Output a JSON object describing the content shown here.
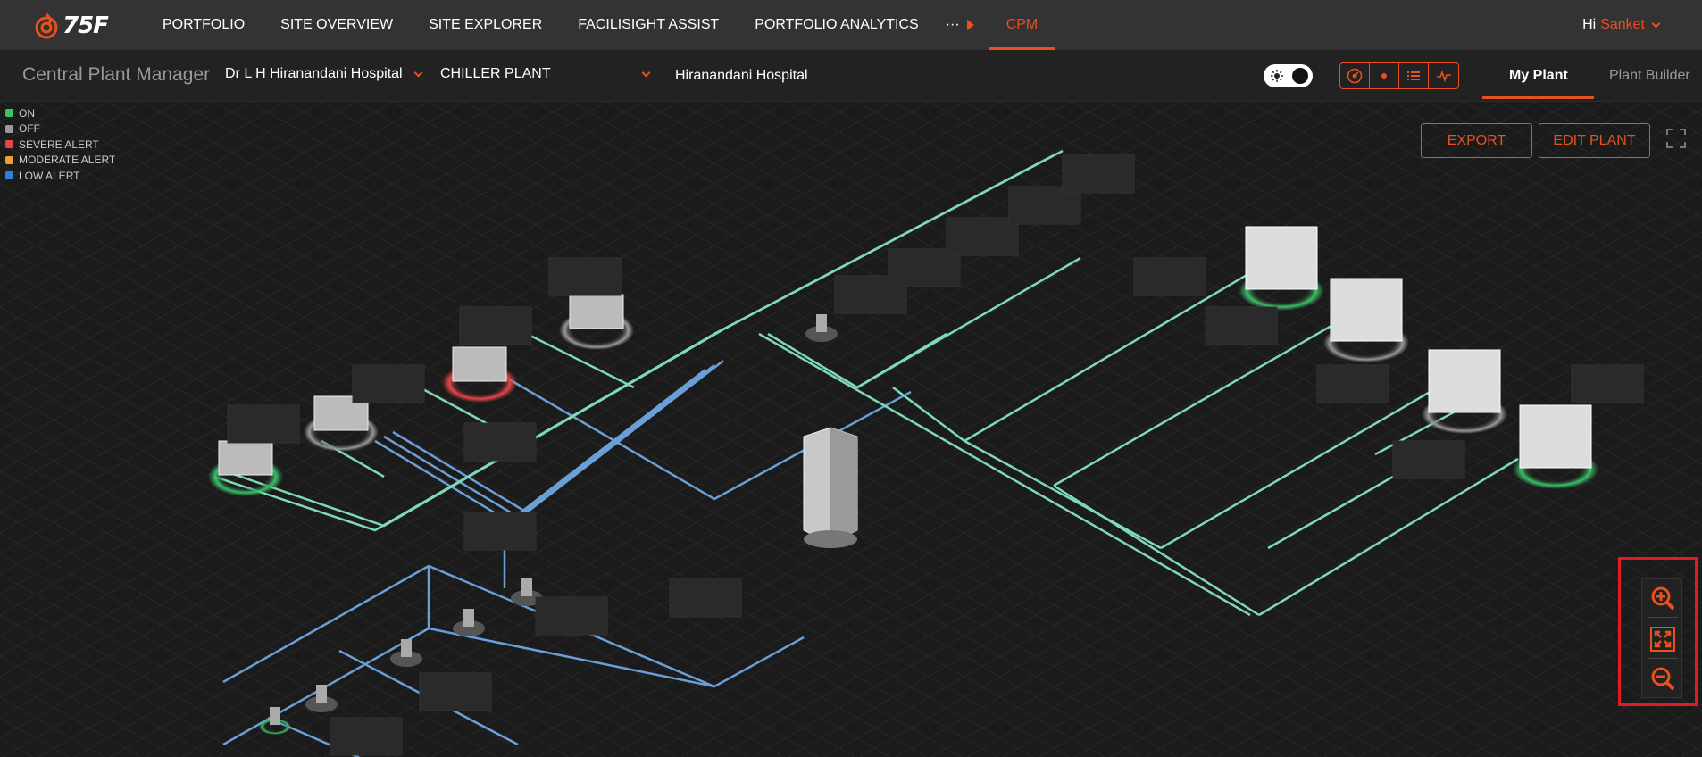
{
  "nav": {
    "logo_text": "75F",
    "items": [
      "PORTFOLIO",
      "SITE OVERVIEW",
      "SITE EXPLORER",
      "FACILISIGHT ASSIST",
      "PORTFOLIO ANALYTICS"
    ],
    "more": "···",
    "active": "CPM",
    "greeting": "Hi",
    "user": "Sanket"
  },
  "subheader": {
    "title": "Central Plant Manager",
    "site_select": "Dr L H Hiranandani Hospital",
    "plant_select": "CHILLER PLANT",
    "site_label": "Hiranandani Hospital",
    "tabs": {
      "my_plant": "My Plant",
      "plant_builder": "Plant Builder"
    }
  },
  "legend": [
    {
      "label": "ON",
      "color": "#3cc06a"
    },
    {
      "label": "OFF",
      "color": "#9a9a9a"
    },
    {
      "label": "SEVERE ALERT",
      "color": "#e8474a"
    },
    {
      "label": "MODERATE ALERT",
      "color": "#f0a030"
    },
    {
      "label": "LOW ALERT",
      "color": "#2e7fd6"
    }
  ],
  "actions": {
    "export": "EXPORT",
    "edit_plant": "EDIT PLANT"
  },
  "colors": {
    "accent": "#e8501e",
    "on": "#3cc06a",
    "pipe_green": "#7fd9b4",
    "pipe_blue": "#6a9fd8",
    "severe": "#e8474a"
  },
  "icons": {
    "toggle": "sun-icon",
    "views": [
      "dashboard-icon",
      "dot-icon",
      "list-icon",
      "pulse-icon"
    ],
    "zoom": [
      "zoom-in-icon",
      "fit-screen-icon",
      "zoom-out-icon"
    ],
    "fullscreen": "fullscreen-icon"
  }
}
